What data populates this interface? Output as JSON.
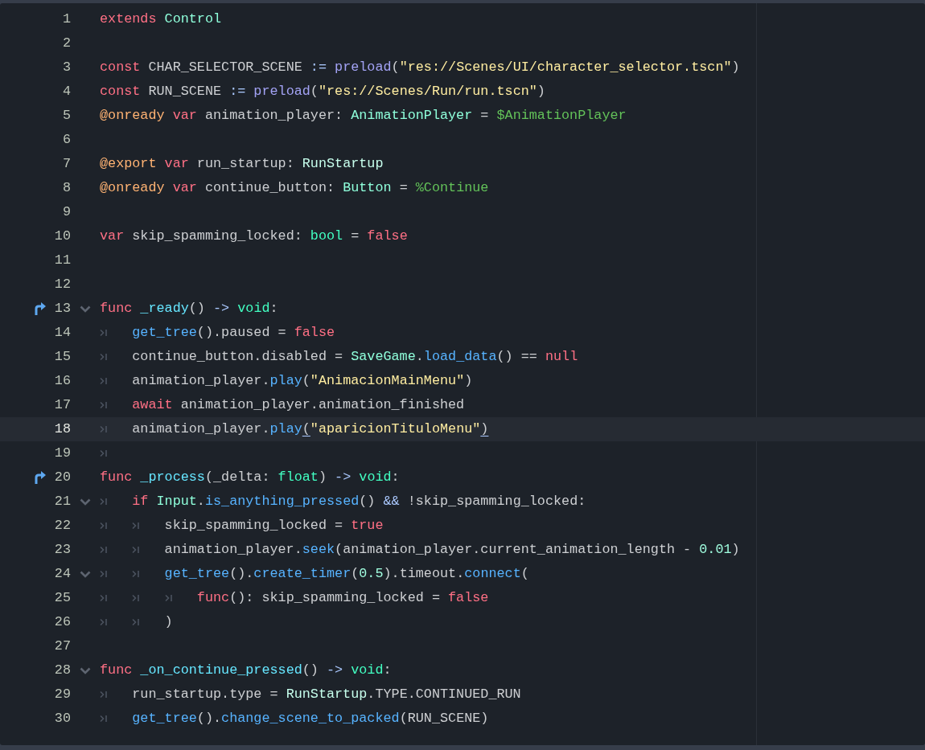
{
  "editor": {
    "lines": [
      {
        "number": "1",
        "fold": false,
        "override": false,
        "current": false,
        "tokens": [
          {
            "kind": "keyword",
            "text": "extends "
          },
          {
            "kind": "engine_type",
            "text": "Control"
          }
        ]
      },
      {
        "number": "2",
        "fold": false,
        "override": false,
        "current": false
      },
      {
        "number": "3",
        "fold": false,
        "override": false,
        "current": false,
        "tokens": [
          {
            "kind": "keyword",
            "text": "const"
          },
          {
            "kind": "plain",
            "text": " CHAR_SELECTOR_SCENE "
          },
          {
            "kind": "symbol",
            "text": ":= "
          },
          {
            "kind": "global_function",
            "text": "preload"
          },
          {
            "kind": "plain",
            "text": "("
          },
          {
            "kind": "string",
            "text": "\"res://Scenes/UI/character_selector.tscn\""
          },
          {
            "kind": "plain",
            "text": ")"
          }
        ]
      },
      {
        "number": "4",
        "fold": false,
        "override": false,
        "current": false,
        "tokens": [
          {
            "kind": "keyword",
            "text": "const"
          },
          {
            "kind": "plain",
            "text": " RUN_SCENE "
          },
          {
            "kind": "symbol",
            "text": ":= "
          },
          {
            "kind": "global_function",
            "text": "preload"
          },
          {
            "kind": "plain",
            "text": "("
          },
          {
            "kind": "string",
            "text": "\"res://Scenes/Run/run.tscn\""
          },
          {
            "kind": "plain",
            "text": ")"
          }
        ]
      },
      {
        "number": "5",
        "fold": false,
        "override": false,
        "current": false,
        "tokens": [
          {
            "kind": "annotation",
            "text": "@onready "
          },
          {
            "kind": "keyword",
            "text": "var"
          },
          {
            "kind": "plain",
            "text": " animation_player: "
          },
          {
            "kind": "engine_type",
            "text": "AnimationPlayer"
          },
          {
            "kind": "plain",
            "text": " = "
          },
          {
            "kind": "node_path",
            "text": "$AnimationPlayer"
          }
        ]
      },
      {
        "number": "6",
        "fold": false,
        "override": false,
        "current": false
      },
      {
        "number": "7",
        "fold": false,
        "override": false,
        "current": false,
        "tokens": [
          {
            "kind": "annotation",
            "text": "@export "
          },
          {
            "kind": "keyword",
            "text": "var"
          },
          {
            "kind": "plain",
            "text": " run_startup: "
          },
          {
            "kind": "user_type",
            "text": "RunStartup"
          }
        ]
      },
      {
        "number": "8",
        "fold": false,
        "override": false,
        "current": false,
        "tokens": [
          {
            "kind": "annotation",
            "text": "@onready "
          },
          {
            "kind": "keyword",
            "text": "var"
          },
          {
            "kind": "plain",
            "text": " continue_button: "
          },
          {
            "kind": "engine_type",
            "text": "Button"
          },
          {
            "kind": "plain",
            "text": " = "
          },
          {
            "kind": "node_path",
            "text": "%Continue"
          }
        ]
      },
      {
        "number": "9",
        "fold": false,
        "override": false,
        "current": false
      },
      {
        "number": "10",
        "fold": false,
        "override": false,
        "current": false,
        "tokens": [
          {
            "kind": "keyword",
            "text": "var"
          },
          {
            "kind": "plain",
            "text": " skip_spamming_locked: "
          },
          {
            "kind": "base_type",
            "text": "bool"
          },
          {
            "kind": "plain",
            "text": " = "
          },
          {
            "kind": "keyword",
            "text": "false"
          }
        ]
      },
      {
        "number": "11",
        "fold": false,
        "override": false,
        "current": false
      },
      {
        "number": "12",
        "fold": false,
        "override": false,
        "current": false
      },
      {
        "number": "13",
        "fold": true,
        "override": true,
        "current": false,
        "tokens": [
          {
            "kind": "keyword",
            "text": "func "
          },
          {
            "kind": "definition",
            "text": "_ready"
          },
          {
            "kind": "plain",
            "text": "() "
          },
          {
            "kind": "symbol",
            "text": "-> "
          },
          {
            "kind": "base_type",
            "text": "void"
          },
          {
            "kind": "plain",
            "text": ":"
          }
        ]
      },
      {
        "number": "14",
        "fold": false,
        "override": false,
        "current": false,
        "tokens": [
          {
            "kind": "tab"
          },
          {
            "kind": "function",
            "text": "get_tree"
          },
          {
            "kind": "plain",
            "text": "().paused = "
          },
          {
            "kind": "keyword",
            "text": "false"
          }
        ]
      },
      {
        "number": "15",
        "fold": false,
        "override": false,
        "current": false,
        "tokens": [
          {
            "kind": "tab"
          },
          {
            "kind": "plain",
            "text": "continue_button.disabled = "
          },
          {
            "kind": "engine_type",
            "text": "SaveGame"
          },
          {
            "kind": "plain",
            "text": "."
          },
          {
            "kind": "function",
            "text": "load_data"
          },
          {
            "kind": "plain",
            "text": "() == "
          },
          {
            "kind": "keyword",
            "text": "null"
          }
        ]
      },
      {
        "number": "16",
        "fold": false,
        "override": false,
        "current": false,
        "tokens": [
          {
            "kind": "tab"
          },
          {
            "kind": "plain",
            "text": "animation_player."
          },
          {
            "kind": "function",
            "text": "play"
          },
          {
            "kind": "plain",
            "text": "("
          },
          {
            "kind": "string",
            "text": "\"AnimacionMainMenu\""
          },
          {
            "kind": "plain",
            "text": ")"
          }
        ]
      },
      {
        "number": "17",
        "fold": false,
        "override": false,
        "current": false,
        "tokens": [
          {
            "kind": "tab"
          },
          {
            "kind": "keyword",
            "text": "await"
          },
          {
            "kind": "plain",
            "text": " animation_player.animation_finished"
          }
        ]
      },
      {
        "number": "18",
        "fold": false,
        "override": false,
        "current": true,
        "tokens": [
          {
            "kind": "tab"
          },
          {
            "kind": "plain",
            "text": "animation_player."
          },
          {
            "kind": "function",
            "text": "play"
          },
          {
            "kind": "matched_bracket",
            "text": "("
          },
          {
            "kind": "string",
            "text": "\"aparicionTituloMenu\""
          },
          {
            "kind": "matched_bracket",
            "text": ")"
          }
        ]
      },
      {
        "number": "19",
        "fold": false,
        "override": false,
        "current": false,
        "tokens": [
          {
            "kind": "tab"
          }
        ]
      },
      {
        "number": "20",
        "fold": false,
        "override": true,
        "current": false,
        "tokens": [
          {
            "kind": "keyword",
            "text": "func "
          },
          {
            "kind": "definition",
            "text": "_process"
          },
          {
            "kind": "plain",
            "text": "(_delta: "
          },
          {
            "kind": "base_type",
            "text": "float"
          },
          {
            "kind": "plain",
            "text": ") "
          },
          {
            "kind": "symbol",
            "text": "-> "
          },
          {
            "kind": "base_type",
            "text": "void"
          },
          {
            "kind": "plain",
            "text": ":"
          }
        ]
      },
      {
        "number": "21",
        "fold": true,
        "override": false,
        "current": false,
        "tokens": [
          {
            "kind": "tab"
          },
          {
            "kind": "keyword",
            "text": "if "
          },
          {
            "kind": "engine_type",
            "text": "Input"
          },
          {
            "kind": "plain",
            "text": "."
          },
          {
            "kind": "function",
            "text": "is_anything_pressed"
          },
          {
            "kind": "plain",
            "text": "() "
          },
          {
            "kind": "symbol",
            "text": "&&"
          },
          {
            "kind": "plain",
            "text": " !skip_spamming_locked:"
          }
        ]
      },
      {
        "number": "22",
        "fold": false,
        "override": false,
        "current": false,
        "tokens": [
          {
            "kind": "tab"
          },
          {
            "kind": "tab"
          },
          {
            "kind": "plain",
            "text": "skip_spamming_locked = "
          },
          {
            "kind": "keyword",
            "text": "true"
          }
        ]
      },
      {
        "number": "23",
        "fold": false,
        "override": false,
        "current": false,
        "tokens": [
          {
            "kind": "tab"
          },
          {
            "kind": "tab"
          },
          {
            "kind": "plain",
            "text": "animation_player."
          },
          {
            "kind": "function",
            "text": "seek"
          },
          {
            "kind": "plain",
            "text": "(animation_player.current_animation_length - "
          },
          {
            "kind": "number",
            "text": "0.01"
          },
          {
            "kind": "plain",
            "text": ")"
          }
        ]
      },
      {
        "number": "24",
        "fold": true,
        "override": false,
        "current": false,
        "tokens": [
          {
            "kind": "tab"
          },
          {
            "kind": "tab"
          },
          {
            "kind": "function",
            "text": "get_tree"
          },
          {
            "kind": "plain",
            "text": "()."
          },
          {
            "kind": "function",
            "text": "create_timer"
          },
          {
            "kind": "plain",
            "text": "("
          },
          {
            "kind": "number",
            "text": "0.5"
          },
          {
            "kind": "plain",
            "text": ").timeout."
          },
          {
            "kind": "function",
            "text": "connect"
          },
          {
            "kind": "plain",
            "text": "("
          }
        ]
      },
      {
        "number": "25",
        "fold": false,
        "override": false,
        "current": false,
        "tokens": [
          {
            "kind": "tab"
          },
          {
            "kind": "tab"
          },
          {
            "kind": "tab"
          },
          {
            "kind": "keyword",
            "text": "func"
          },
          {
            "kind": "plain",
            "text": "(): skip_spamming_locked = "
          },
          {
            "kind": "keyword",
            "text": "false"
          }
        ]
      },
      {
        "number": "26",
        "fold": false,
        "override": false,
        "current": false,
        "tokens": [
          {
            "kind": "tab"
          },
          {
            "kind": "tab"
          },
          {
            "kind": "plain",
            "text": ")"
          }
        ]
      },
      {
        "number": "27",
        "fold": false,
        "override": false,
        "current": false
      },
      {
        "number": "28",
        "fold": true,
        "override": false,
        "current": false,
        "tokens": [
          {
            "kind": "keyword",
            "text": "func "
          },
          {
            "kind": "definition",
            "text": "_on_continue_pressed"
          },
          {
            "kind": "plain",
            "text": "() "
          },
          {
            "kind": "symbol",
            "text": "-> "
          },
          {
            "kind": "base_type",
            "text": "void"
          },
          {
            "kind": "plain",
            "text": ":"
          }
        ]
      },
      {
        "number": "29",
        "fold": false,
        "override": false,
        "current": false,
        "tokens": [
          {
            "kind": "tab"
          },
          {
            "kind": "plain",
            "text": "run_startup.type = "
          },
          {
            "kind": "user_type",
            "text": "RunStartup"
          },
          {
            "kind": "plain",
            "text": ".TYPE.CONTINUED_RUN"
          }
        ]
      },
      {
        "number": "30",
        "fold": false,
        "override": false,
        "current": false,
        "tokens": [
          {
            "kind": "tab"
          },
          {
            "kind": "function",
            "text": "get_tree"
          },
          {
            "kind": "plain",
            "text": "()."
          },
          {
            "kind": "function",
            "text": "change_scene_to_packed"
          },
          {
            "kind": "plain",
            "text": "(RUN_SCENE)"
          }
        ]
      }
    ]
  }
}
